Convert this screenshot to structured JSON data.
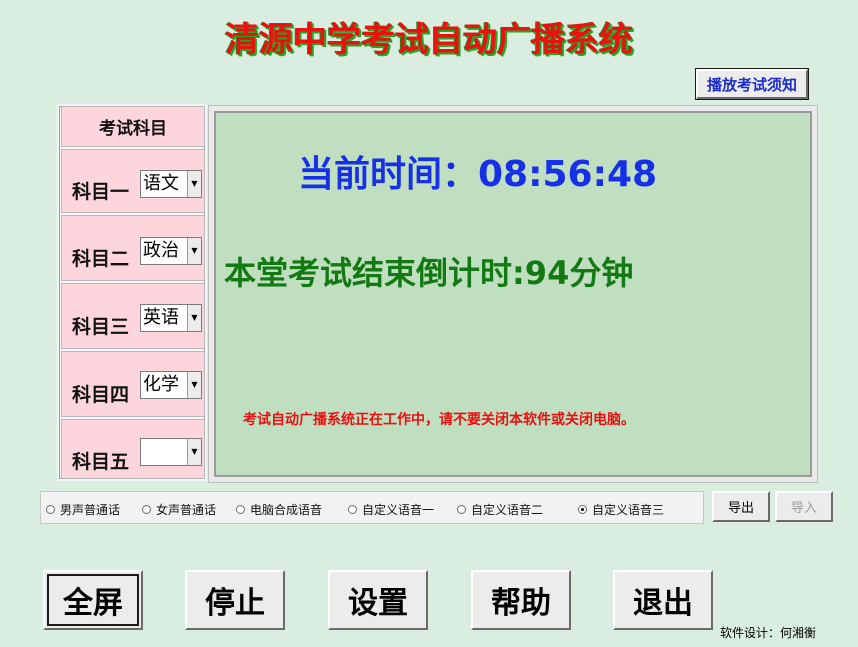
{
  "app": {
    "title": "清源中学考试自动广播系统"
  },
  "toolbar": {
    "rules_button": "播放考试须知"
  },
  "subjects": {
    "header": "考试科目",
    "items": [
      {
        "label": "科目一",
        "value": "语文"
      },
      {
        "label": "科目二",
        "value": "政治"
      },
      {
        "label": "科目三",
        "value": "英语"
      },
      {
        "label": "科目四",
        "value": "化学"
      },
      {
        "label": "科目五",
        "value": ""
      }
    ]
  },
  "display": {
    "current_time": "当前时间：08:56:48",
    "countdown": "本堂考试结束倒计时:94分钟",
    "notice": "考试自动广播系统正在工作中，请不要关闭本软件或关闭电脑。"
  },
  "voice": {
    "options": [
      {
        "label": "男声普通话",
        "selected": false
      },
      {
        "label": "女声普通话",
        "selected": false
      },
      {
        "label": "电脑合成语音",
        "selected": false
      },
      {
        "label": "自定义语音一",
        "selected": false
      },
      {
        "label": "自定义语音二",
        "selected": false
      },
      {
        "label": "自定义语音三",
        "selected": true
      }
    ],
    "export_label": "导出",
    "import_label": "导入"
  },
  "actions": {
    "fullscreen": "全屏",
    "stop": "停止",
    "settings": "设置",
    "help": "帮助",
    "exit": "退出"
  },
  "footer": {
    "credit": "软件设计：何湘衡"
  },
  "colors": {
    "background": "#d9ede0",
    "display_bg": "#c0dfc0",
    "subject_bg": "#fcd6dc",
    "title_red": "#ee1010",
    "time_blue": "#1530e6",
    "countdown_green": "#137a13"
  }
}
